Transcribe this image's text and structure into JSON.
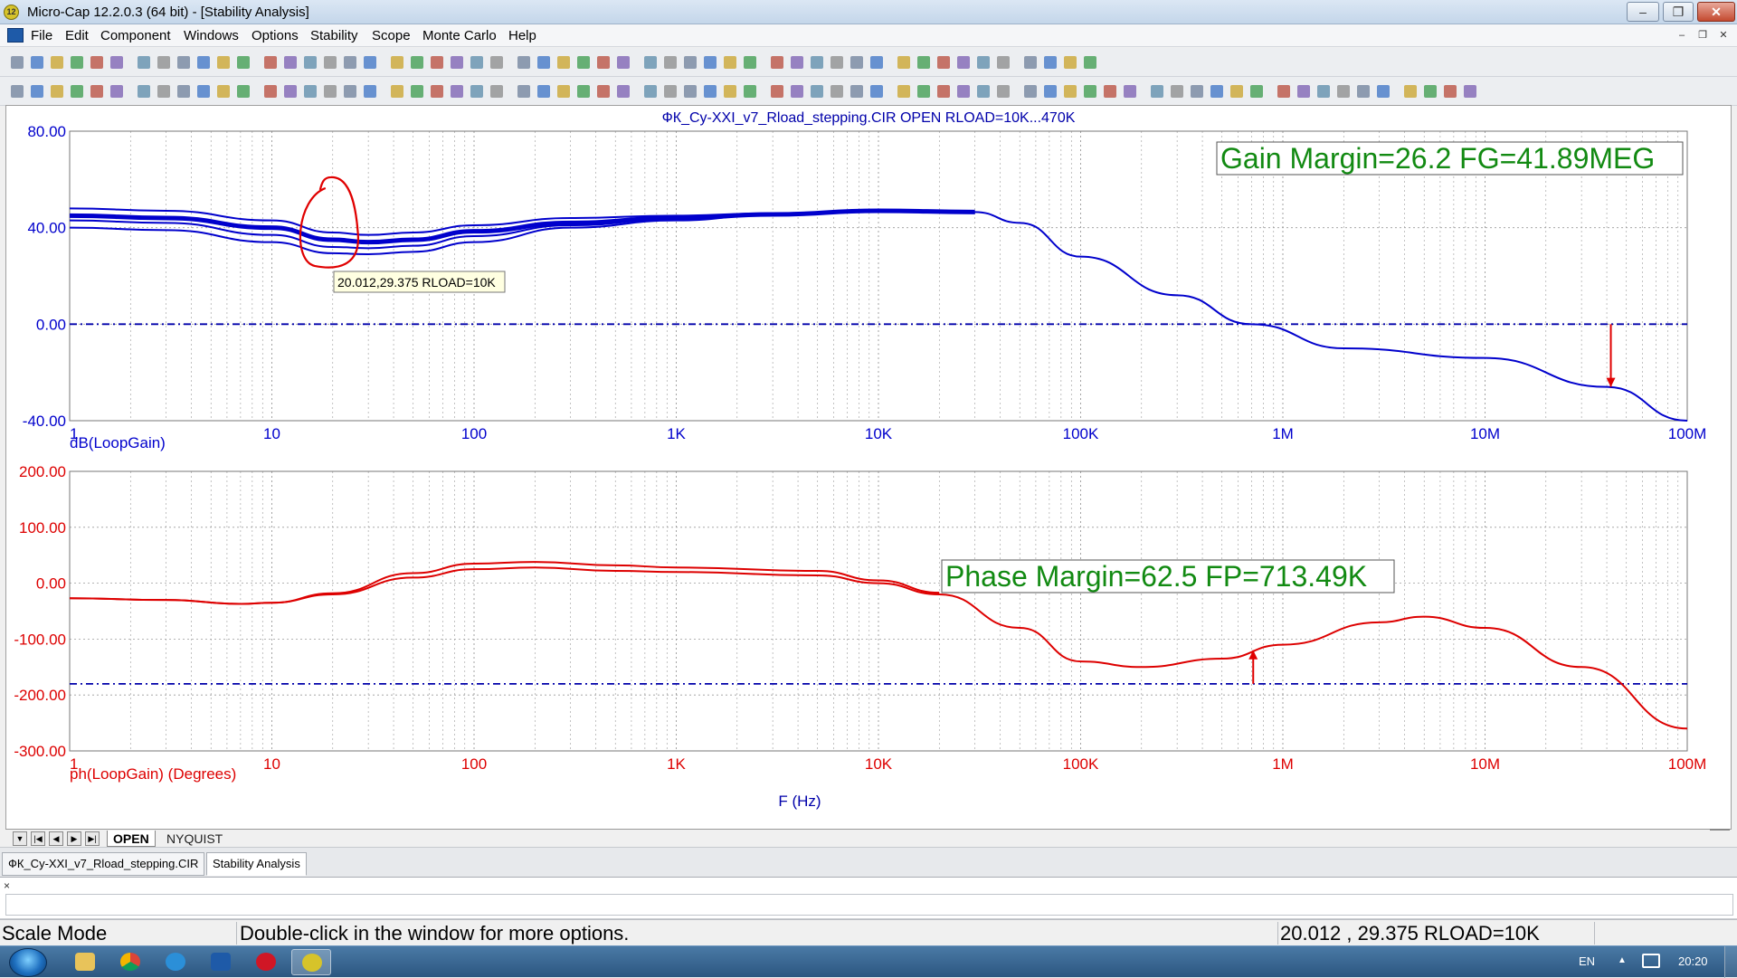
{
  "window": {
    "title": "Micro-Cap 12.2.0.3 (64 bit) - [Stability Analysis]",
    "app_icon": "microcap-app-icon",
    "controls": [
      "minimize",
      "restore",
      "close"
    ]
  },
  "menu": {
    "items": [
      "File",
      "Edit",
      "Component",
      "Windows",
      "Options",
      "Stability",
      "Scope",
      "Monte Carlo",
      "Help"
    ]
  },
  "chart_data": [
    {
      "type": "line",
      "title": "ФК_Су-XXI_v7_Rload_stepping.CIR OPEN RLOAD=10K...470K",
      "x_scale": "log",
      "xlim": [
        1,
        100000000
      ],
      "x_ticks": [
        "1",
        "10",
        "100",
        "1K",
        "10K",
        "100K",
        "1M",
        "10M",
        "100M"
      ],
      "ylabel": "dB(LoopGain)",
      "ylim": [
        -40,
        80
      ],
      "y_ticks": [
        "80.00",
        "40.00",
        "0.00",
        "-40.00"
      ],
      "grid": true,
      "reference_line": 0,
      "color": "#0000cc",
      "series": [
        {
          "x": [
            1,
            3,
            10,
            20,
            30,
            50,
            100,
            300,
            1000,
            3000,
            10000,
            30000,
            50000,
            100000,
            300000,
            700000,
            2000000,
            10000000,
            40000000,
            100000000
          ],
          "y": [
            48,
            47,
            43,
            38,
            37,
            38,
            41,
            44,
            45,
            46,
            47,
            46.5,
            42,
            28,
            12,
            0,
            -10,
            -14,
            -26,
            -40
          ]
        },
        {
          "x": [
            1,
            3,
            10,
            20,
            30,
            50,
            100,
            300,
            1000,
            3000,
            10000,
            30000
          ],
          "y": [
            45,
            44,
            40,
            35,
            34,
            35,
            38.5,
            42,
            44,
            45.5,
            47,
            46.5
          ]
        },
        {
          "x": [
            1,
            3,
            10,
            20,
            30,
            50,
            100,
            300,
            1000,
            3000,
            10000,
            30000
          ],
          "y": [
            43,
            42,
            37,
            32,
            31.5,
            32.5,
            36.5,
            41,
            43.5,
            45.5,
            47,
            46.5
          ]
        },
        {
          "x": [
            1,
            3,
            10,
            20,
            30,
            50,
            100,
            300,
            1000,
            3000,
            10000,
            30000
          ],
          "y": [
            40,
            39,
            34,
            29.4,
            29,
            30,
            34,
            40,
            43,
            45.5,
            47,
            46.5
          ]
        }
      ],
      "annotations": {
        "margin_label": "Gain Margin=26.2 FG=41.89MEG",
        "tooltip": "20.012,29.375 RLOAD=10K",
        "marker_x": 41890000
      }
    },
    {
      "type": "line",
      "x_scale": "log",
      "xlim": [
        1,
        100000000
      ],
      "x_ticks": [
        "1",
        "10",
        "100",
        "1K",
        "10K",
        "100K",
        "1M",
        "10M",
        "100M"
      ],
      "xlabel": "F (Hz)",
      "ylabel": "ph(LoopGain) (Degrees)",
      "ylim": [
        -300,
        200
      ],
      "y_ticks": [
        "200.00",
        "100.00",
        "0.00",
        "-100.00",
        "-200.00",
        "-300.00"
      ],
      "grid": true,
      "reference_line": -180,
      "color": "#dd0000",
      "series": [
        {
          "x": [
            1,
            3,
            7,
            10,
            20,
            50,
            100,
            200,
            500,
            1000,
            5000,
            10000,
            20000,
            50000,
            100000,
            200000,
            500000,
            1000000,
            3000000,
            5000000,
            10000000,
            30000000,
            100000000
          ],
          "y": [
            -27,
            -30,
            -37,
            -35,
            -20,
            10,
            25,
            28,
            22,
            20,
            14,
            0,
            -20,
            -80,
            -140,
            -150,
            -135,
            -110,
            -70,
            -60,
            -80,
            -150,
            -260
          ]
        },
        {
          "x": [
            1,
            3,
            7,
            10,
            20,
            50,
            100,
            200,
            500,
            1000,
            5000,
            10000,
            20000
          ],
          "y": [
            -27,
            -30,
            -37,
            -35,
            -18,
            18,
            35,
            38,
            32,
            28,
            22,
            5,
            -17
          ]
        }
      ],
      "annotations": {
        "margin_label": "Phase Margin=62.5 FP=713.49K",
        "marker_x": 713490
      }
    }
  ],
  "plot_tabs": {
    "active": "OPEN",
    "other": "NYQUIST"
  },
  "doc_tabs": [
    "ФК_Су-XXI_v7_Rload_stepping.CIR",
    "Stability Analysis"
  ],
  "output": {
    "close_glyph": "×"
  },
  "status": {
    "mode": "Scale Mode",
    "hint": "Double-click in the window for more options.",
    "cursor": "20.012 , 29.375 RLOAD=10K"
  },
  "taskbar": {
    "apps": [
      "file-explorer-icon",
      "chrome-icon",
      "ie-icon",
      "microcap-small-icon",
      "opera-icon",
      "microcap-icon"
    ],
    "language": "EN",
    "tray_up": "▲",
    "clock": "20:20"
  },
  "colors": {
    "gain_trace": "#0000cc",
    "phase_trace": "#dd0000",
    "margin_text": "#128a12",
    "highlight": "#e00000"
  }
}
